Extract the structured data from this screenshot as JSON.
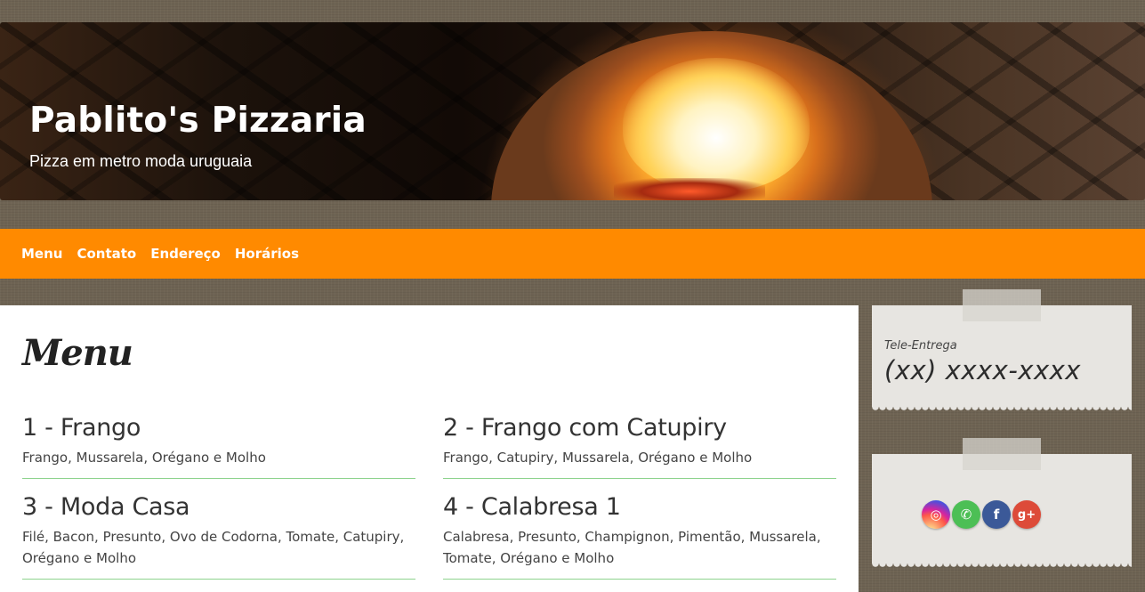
{
  "header": {
    "title": "Pablito's Pizzaria",
    "subtitle": "Pizza em metro moda uruguaia"
  },
  "nav": {
    "items": [
      {
        "label": "Menu"
      },
      {
        "label": "Contato"
      },
      {
        "label": "Endereço"
      },
      {
        "label": "Horários"
      }
    ],
    "color": "#ff8a00"
  },
  "menu": {
    "heading": "Menu",
    "items": [
      {
        "name": "1 - Frango",
        "description": "Frango, Mussarela, Orégano e Molho"
      },
      {
        "name": "2 - Frango com Catupiry",
        "description": "Frango, Catupiry, Mussarela, Orégano e Molho"
      },
      {
        "name": "3 - Moda Casa",
        "description": "Filé, Bacon, Presunto, Ovo de Codorna, Tomate, Catupiry, Orégano e Molho"
      },
      {
        "name": "4 - Calabresa 1",
        "description": "Calabresa, Presunto, Champignon, Pimentão, Mussarela, Tomate, Orégano e Molho"
      }
    ]
  },
  "sidebar": {
    "delivery_label": "Tele-Entrega",
    "phone": "(xx)  xxxx-xxxx",
    "social": [
      {
        "icon": "instagram-icon",
        "glyph": "◎",
        "color": "#d6249f"
      },
      {
        "icon": "whatsapp-icon",
        "glyph": "✆",
        "color": "#4cbf55"
      },
      {
        "icon": "facebook-icon",
        "glyph": "f",
        "color": "#3b5998"
      },
      {
        "icon": "google-plus-icon",
        "glyph": "g+",
        "color": "#dd4b39"
      }
    ]
  }
}
